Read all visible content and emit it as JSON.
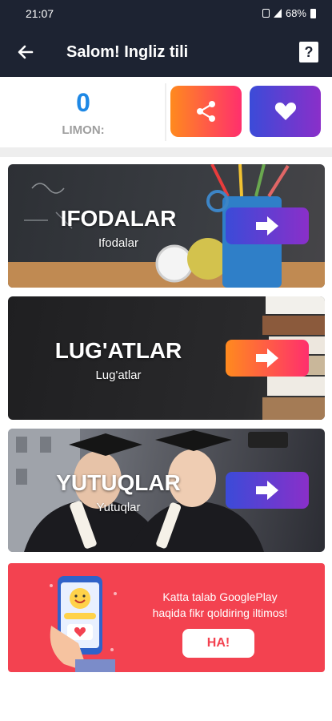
{
  "status_bar": {
    "time": "21:07",
    "battery": "68%"
  },
  "app_bar": {
    "title": "Salom! Ingliz tili",
    "help_glyph": "?"
  },
  "score": {
    "value": "0",
    "label": "LIMON:"
  },
  "actions": {
    "share_icon": "share-icon",
    "favorite_icon": "heart-icon"
  },
  "cards": [
    {
      "title": "IFODALAR",
      "subtitle": "Ifodalar"
    },
    {
      "title": "LUG'ATLAR",
      "subtitle": "Lug'atlar"
    },
    {
      "title": "YUTUQLAR",
      "subtitle": "Yutuqlar"
    }
  ],
  "promo": {
    "line1": "Katta talab GooglePlay",
    "line2": "haqida fikr qoldiring iltimos!",
    "button": "HA!"
  },
  "colors": {
    "dark_bar": "#1d2332",
    "accent_blue": "#1e88e5",
    "gradient_orange": [
      "#ff8a1e",
      "#ff2f6d"
    ],
    "gradient_purple": [
      "#3b4bd8",
      "#8a2fc9"
    ],
    "promo_red": "#f34250"
  }
}
